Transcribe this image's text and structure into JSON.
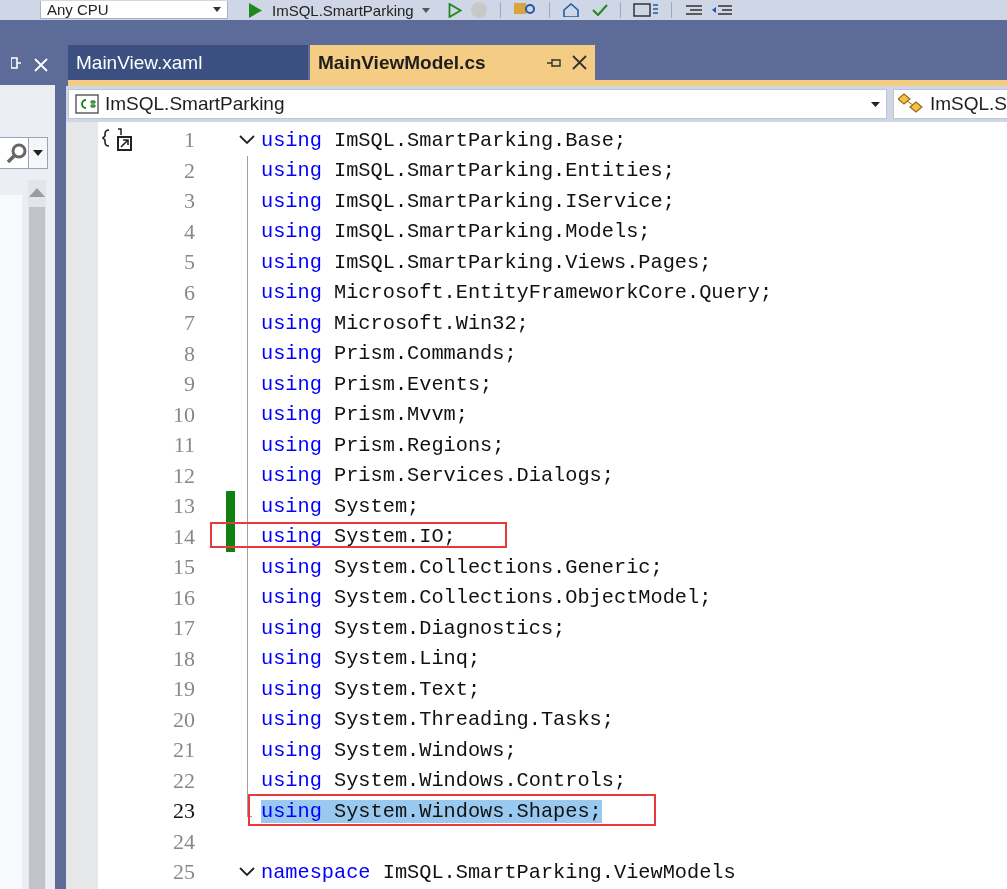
{
  "toolbar": {
    "platform": "Any CPU",
    "startup_project": "ImSQL.SmartParking"
  },
  "tabs": [
    {
      "label": "MainView.xaml",
      "selected": false
    },
    {
      "label": "MainViewModel.cs",
      "selected": true
    }
  ],
  "nav_bar": {
    "project": "ImSQL.SmartParking",
    "type": "ImSQL.S"
  },
  "lines": [
    {
      "number": "1",
      "keyword": "using",
      "text": "ImSQL.SmartParking.Base;",
      "foldable": true,
      "changed": false,
      "selected": false,
      "boxed": false
    },
    {
      "number": "2",
      "keyword": "using",
      "text": "ImSQL.SmartParking.Entities;",
      "foldable": false,
      "changed": false,
      "selected": false,
      "boxed": false
    },
    {
      "number": "3",
      "keyword": "using",
      "text": "ImSQL.SmartParking.IService;",
      "foldable": false,
      "changed": false,
      "selected": false,
      "boxed": false
    },
    {
      "number": "4",
      "keyword": "using",
      "text": "ImSQL.SmartParking.Models;",
      "foldable": false,
      "changed": false,
      "selected": false,
      "boxed": false
    },
    {
      "number": "5",
      "keyword": "using",
      "text": "ImSQL.SmartParking.Views.Pages;",
      "foldable": false,
      "changed": false,
      "selected": false,
      "boxed": false
    },
    {
      "number": "6",
      "keyword": "using",
      "text": "Microsoft.EntityFrameworkCore.Query;",
      "foldable": false,
      "changed": false,
      "selected": false,
      "boxed": false
    },
    {
      "number": "7",
      "keyword": "using",
      "text": "Microsoft.Win32;",
      "foldable": false,
      "changed": false,
      "selected": false,
      "boxed": false
    },
    {
      "number": "8",
      "keyword": "using",
      "text": "Prism.Commands;",
      "foldable": false,
      "changed": false,
      "selected": false,
      "boxed": false
    },
    {
      "number": "9",
      "keyword": "using",
      "text": "Prism.Events;",
      "foldable": false,
      "changed": false,
      "selected": false,
      "boxed": false
    },
    {
      "number": "10",
      "keyword": "using",
      "text": "Prism.Mvvm;",
      "foldable": false,
      "changed": false,
      "selected": false,
      "boxed": false
    },
    {
      "number": "11",
      "keyword": "using",
      "text": "Prism.Regions;",
      "foldable": false,
      "changed": false,
      "selected": false,
      "boxed": false
    },
    {
      "number": "12",
      "keyword": "using",
      "text": "Prism.Services.Dialogs;",
      "foldable": false,
      "changed": false,
      "selected": false,
      "boxed": false
    },
    {
      "number": "13",
      "keyword": "using",
      "text": "System;",
      "foldable": false,
      "changed": true,
      "selected": false,
      "boxed": false
    },
    {
      "number": "14",
      "keyword": "using",
      "text": "System.IO;",
      "foldable": false,
      "changed": true,
      "selected": false,
      "boxed": true
    },
    {
      "number": "15",
      "keyword": "using",
      "text": "System.Collections.Generic;",
      "foldable": false,
      "changed": false,
      "selected": false,
      "boxed": false
    },
    {
      "number": "16",
      "keyword": "using",
      "text": "System.Collections.ObjectModel;",
      "foldable": false,
      "changed": false,
      "selected": false,
      "boxed": false
    },
    {
      "number": "17",
      "keyword": "using",
      "text": "System.Diagnostics;",
      "foldable": false,
      "changed": false,
      "selected": false,
      "boxed": false
    },
    {
      "number": "18",
      "keyword": "using",
      "text": "System.Linq;",
      "foldable": false,
      "changed": false,
      "selected": false,
      "boxed": false
    },
    {
      "number": "19",
      "keyword": "using",
      "text": "System.Text;",
      "foldable": false,
      "changed": false,
      "selected": false,
      "boxed": false
    },
    {
      "number": "20",
      "keyword": "using",
      "text": "System.Threading.Tasks;",
      "foldable": false,
      "changed": false,
      "selected": false,
      "boxed": false
    },
    {
      "number": "21",
      "keyword": "using",
      "text": "System.Windows;",
      "foldable": false,
      "changed": false,
      "selected": false,
      "boxed": false
    },
    {
      "number": "22",
      "keyword": "using",
      "text": "System.Windows.Controls;",
      "foldable": false,
      "changed": false,
      "selected": false,
      "boxed": false
    },
    {
      "number": "23",
      "keyword": "using",
      "text": "System.Windows.Shapes;",
      "foldable": false,
      "changed": false,
      "selected": true,
      "boxed": true
    },
    {
      "number": "24",
      "foldable": false,
      "changed": false,
      "selected": false,
      "boxed": false
    },
    {
      "number": "25",
      "keyword": "namespace",
      "text": "ImSQL.SmartParking.ViewModels",
      "foldable": true,
      "changed": false,
      "selected": false,
      "boxed": false
    }
  ]
}
